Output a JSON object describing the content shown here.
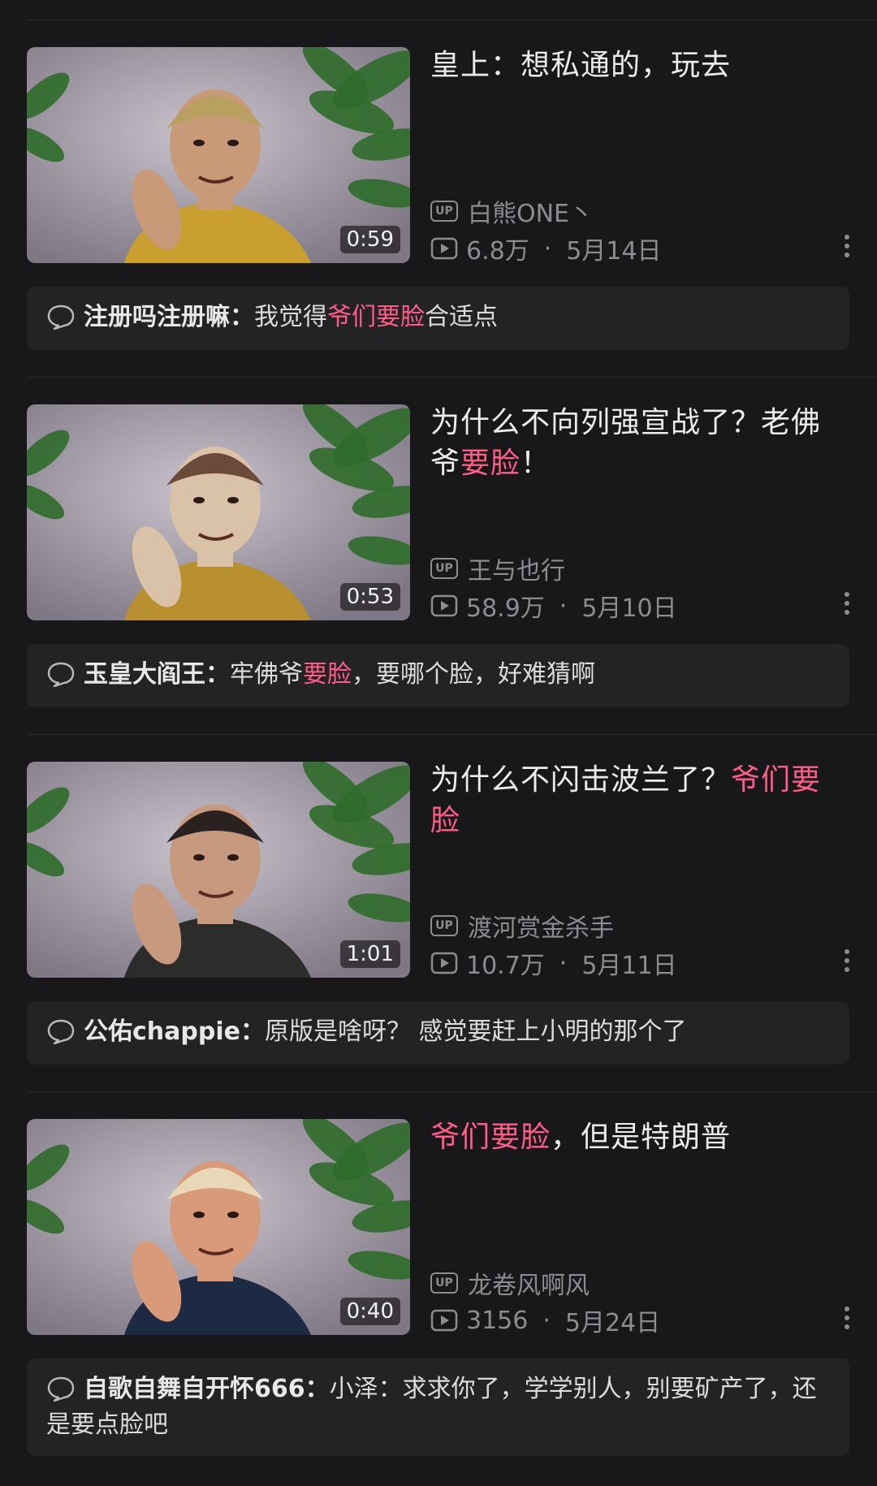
{
  "videos": [
    {
      "duration": "0:59",
      "title_parts": [
        "皇上：想私通的，玩去"
      ],
      "title_highlights": [
        false
      ],
      "uploader": "白熊ONE丶",
      "views": "6.8万",
      "date": "5月14日",
      "comment_user": "注册吗注册嘛：",
      "comment_parts": [
        "我觉得",
        "爷们要脸",
        "合适点"
      ],
      "comment_highlights": [
        false,
        true,
        false
      ]
    },
    {
      "duration": "0:53",
      "title_parts": [
        "为什么不向列强宣战了？老佛爷",
        "要脸",
        "！"
      ],
      "title_highlights": [
        false,
        true,
        false
      ],
      "uploader": "王与也行",
      "views": "58.9万",
      "date": "5月10日",
      "comment_user": "玉皇大阎王：",
      "comment_parts": [
        "牢佛爷",
        "要脸",
        "，要哪个脸，好难猜啊"
      ],
      "comment_highlights": [
        false,
        true,
        false
      ]
    },
    {
      "duration": "1:01",
      "title_parts": [
        "为什么不闪击波兰了？",
        "爷们要脸"
      ],
      "title_highlights": [
        false,
        true
      ],
      "uploader": "渡河赏金杀手",
      "views": "10.7万",
      "date": "5月11日",
      "comment_user": "公佑chappie：",
      "comment_parts": [
        "原版是啥呀？ 感觉要赶上小明的那个了"
      ],
      "comment_highlights": [
        false
      ]
    },
    {
      "duration": "0:40",
      "title_parts": [
        "爷们要脸",
        "，但是特朗普"
      ],
      "title_highlights": [
        true,
        false
      ],
      "uploader": "龙卷风啊风",
      "views": "3156",
      "date": "5月24日",
      "comment_user": "自歌自舞自开怀666：",
      "comment_parts": [
        "小泽：求求你了，学学别人，别要矿产了，还是要点脸吧"
      ],
      "comment_highlights": [
        false
      ]
    }
  ],
  "labels": {
    "up_badge": "UP",
    "dot": "·"
  },
  "colors": {
    "background": "#18181a",
    "highlight": "#ff5c8a",
    "meta": "#8d8d91",
    "comment_bg": "#232326"
  },
  "icons": {
    "up": "up-badge-icon",
    "play": "play-count-icon",
    "more": "more-vertical-icon",
    "comment": "comment-bubble-icon"
  },
  "thumbnails": [
    {
      "subject": "man in yellow cap",
      "hat": "#b8a060",
      "skin": "#c89a78",
      "cloth": "#c9a030"
    },
    {
      "subject": "woman in headdress",
      "hat": "#6b4a3a",
      "skin": "#d9c2a8",
      "cloth": "#b89030"
    },
    {
      "subject": "man in dark suit",
      "hat": "#2a2220",
      "skin": "#c79a80",
      "cloth": "#2c2c2a"
    },
    {
      "subject": "man in navy suit",
      "hat": "#e8d8b8",
      "skin": "#d89a78",
      "cloth": "#1e2a44"
    }
  ]
}
